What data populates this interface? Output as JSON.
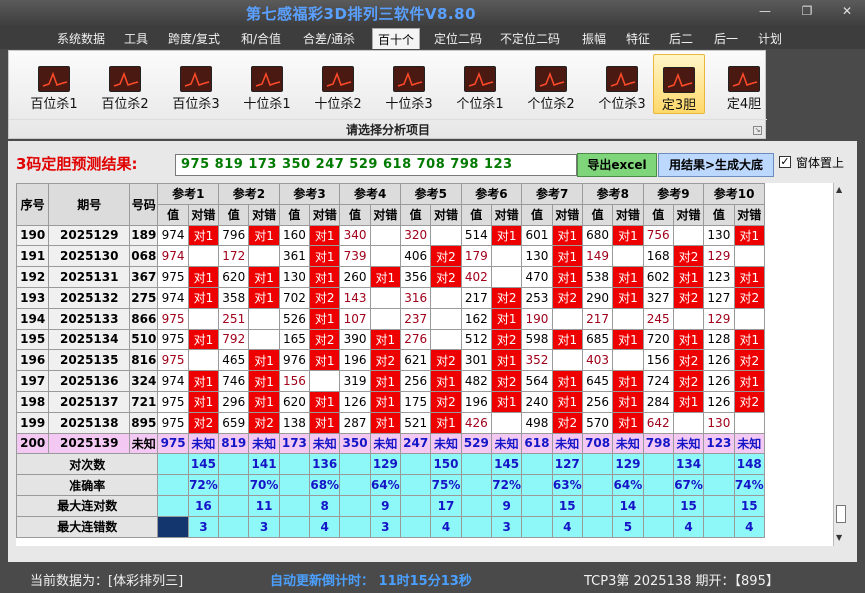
{
  "app": {
    "title": "第七感福彩3D排列三软件V8.80",
    "window_buttons": [
      "—",
      "❐",
      "✕"
    ]
  },
  "menu": [
    "系统数据",
    "工具",
    "跨度/复式",
    "和/合值",
    "合差/通杀",
    "百十个",
    "定位二码",
    "不定位二码",
    "振幅",
    "特征",
    "后二",
    "后一",
    "计划"
  ],
  "menu_active_index": 5,
  "ribbon": {
    "buttons": [
      "百位杀1",
      "百位杀2",
      "百位杀3",
      "十位杀1",
      "十位杀2",
      "十位杀3",
      "个位杀1",
      "个位杀2",
      "个位杀3",
      "定3胆",
      "定4胆"
    ],
    "selected_index": 9,
    "caption": "请选择分析项目"
  },
  "result": {
    "label": "3码定胆预测结果:",
    "value": "975 819 173 350 247 529 618 708 798 123",
    "export_button": "导出excel",
    "chart_button": "用结果>生成大底",
    "pin_checked": true,
    "pin_label": "窗体置上"
  },
  "grid": {
    "headers": {
      "seq": "序号",
      "issue": "期号",
      "code": "号码",
      "val": "值",
      "cmp": "对错"
    },
    "ref_names": [
      "参考1",
      "参考2",
      "参考3",
      "参考4",
      "参考5",
      "参考6",
      "参考7",
      "参考8",
      "参考9",
      "参考10"
    ],
    "rows": [
      {
        "seq": "190",
        "issue": "2025129",
        "code": "189",
        "refs": [
          [
            "974",
            "对1"
          ],
          [
            "796",
            "对1"
          ],
          [
            "160",
            "对1"
          ],
          [
            "340",
            ""
          ],
          [
            "320",
            ""
          ],
          [
            "514",
            "对1"
          ],
          [
            "601",
            "对1"
          ],
          [
            "680",
            "对1"
          ],
          [
            "756",
            ""
          ],
          [
            "130",
            "对1"
          ]
        ]
      },
      {
        "seq": "191",
        "issue": "2025130",
        "code": "068",
        "refs": [
          [
            "974",
            ""
          ],
          [
            "172",
            ""
          ],
          [
            "361",
            "对1"
          ],
          [
            "739",
            ""
          ],
          [
            "406",
            "对2"
          ],
          [
            "179",
            ""
          ],
          [
            "130",
            "对1"
          ],
          [
            "149",
            ""
          ],
          [
            "168",
            "对2"
          ],
          [
            "129",
            ""
          ]
        ]
      },
      {
        "seq": "192",
        "issue": "2025131",
        "code": "367",
        "refs": [
          [
            "975",
            "对1"
          ],
          [
            "620",
            "对1"
          ],
          [
            "130",
            "对1"
          ],
          [
            "260",
            "对1"
          ],
          [
            "356",
            "对2"
          ],
          [
            "402",
            ""
          ],
          [
            "470",
            "对1"
          ],
          [
            "538",
            "对1"
          ],
          [
            "602",
            "对1"
          ],
          [
            "123",
            "对1"
          ]
        ]
      },
      {
        "seq": "193",
        "issue": "2025132",
        "code": "275",
        "refs": [
          [
            "974",
            "对1"
          ],
          [
            "358",
            "对1"
          ],
          [
            "702",
            "对2"
          ],
          [
            "143",
            ""
          ],
          [
            "316",
            ""
          ],
          [
            "217",
            "对2"
          ],
          [
            "253",
            "对2"
          ],
          [
            "290",
            "对1"
          ],
          [
            "327",
            "对2"
          ],
          [
            "127",
            "对2"
          ]
        ]
      },
      {
        "seq": "194",
        "issue": "2025133",
        "code": "866",
        "refs": [
          [
            "975",
            ""
          ],
          [
            "251",
            ""
          ],
          [
            "526",
            "对1"
          ],
          [
            "107",
            ""
          ],
          [
            "237",
            ""
          ],
          [
            "162",
            "对1"
          ],
          [
            "190",
            ""
          ],
          [
            "217",
            ""
          ],
          [
            "245",
            ""
          ],
          [
            "129",
            ""
          ]
        ]
      },
      {
        "seq": "195",
        "issue": "2025134",
        "code": "510",
        "refs": [
          [
            "975",
            "对1"
          ],
          [
            "792",
            ""
          ],
          [
            "165",
            "对2"
          ],
          [
            "390",
            "对1"
          ],
          [
            "276",
            ""
          ],
          [
            "512",
            "对2"
          ],
          [
            "598",
            "对1"
          ],
          [
            "685",
            "对1"
          ],
          [
            "720",
            "对1"
          ],
          [
            "128",
            "对1"
          ]
        ]
      },
      {
        "seq": "196",
        "issue": "2025135",
        "code": "816",
        "refs": [
          [
            "975",
            ""
          ],
          [
            "465",
            "对1"
          ],
          [
            "976",
            "对1"
          ],
          [
            "196",
            "对2"
          ],
          [
            "621",
            "对2"
          ],
          [
            "301",
            "对1"
          ],
          [
            "352",
            ""
          ],
          [
            "403",
            ""
          ],
          [
            "156",
            "对2"
          ],
          [
            "126",
            "对2"
          ]
        ]
      },
      {
        "seq": "197",
        "issue": "2025136",
        "code": "324",
        "refs": [
          [
            "974",
            "对1"
          ],
          [
            "746",
            "对1"
          ],
          [
            "156",
            ""
          ],
          [
            "319",
            "对1"
          ],
          [
            "256",
            "对1"
          ],
          [
            "482",
            "对2"
          ],
          [
            "564",
            "对1"
          ],
          [
            "645",
            "对1"
          ],
          [
            "724",
            "对2"
          ],
          [
            "126",
            "对1"
          ]
        ]
      },
      {
        "seq": "198",
        "issue": "2025137",
        "code": "721",
        "refs": [
          [
            "975",
            "对1"
          ],
          [
            "296",
            "对1"
          ],
          [
            "620",
            "对1"
          ],
          [
            "126",
            "对1"
          ],
          [
            "175",
            "对2"
          ],
          [
            "196",
            "对1"
          ],
          [
            "240",
            "对1"
          ],
          [
            "256",
            "对1"
          ],
          [
            "284",
            "对1"
          ],
          [
            "126",
            "对2"
          ]
        ]
      },
      {
        "seq": "199",
        "issue": "2025138",
        "code": "895",
        "refs": [
          [
            "975",
            "对2"
          ],
          [
            "659",
            "对2"
          ],
          [
            "138",
            "对1"
          ],
          [
            "287",
            "对1"
          ],
          [
            "521",
            "对1"
          ],
          [
            "426",
            ""
          ],
          [
            "498",
            "对2"
          ],
          [
            "570",
            "对1"
          ],
          [
            "642",
            ""
          ],
          [
            "130",
            ""
          ]
        ]
      }
    ],
    "last_row": {
      "seq": "200",
      "issue": "2025139",
      "code": "未知",
      "values": [
        "975",
        "819",
        "173",
        "350",
        "247",
        "529",
        "618",
        "708",
        "798",
        "123"
      ],
      "status": "未知"
    },
    "stats": [
      {
        "label": "对次数",
        "values": [
          "145",
          "141",
          "136",
          "129",
          "150",
          "145",
          "127",
          "129",
          "134",
          "148"
        ]
      },
      {
        "label": "准确率",
        "values": [
          "72%",
          "70%",
          "68%",
          "64%",
          "75%",
          "72%",
          "63%",
          "64%",
          "67%",
          "74%"
        ]
      },
      {
        "label": "最大连对数",
        "values": [
          "16",
          "11",
          "8",
          "9",
          "17",
          "9",
          "15",
          "14",
          "15",
          "15"
        ]
      },
      {
        "label": "最大连错数",
        "values": [
          "3",
          "3",
          "4",
          "3",
          "4",
          "3",
          "4",
          "5",
          "4",
          "4"
        ]
      }
    ]
  },
  "status": {
    "data_source": "当前数据为：[体彩排列三]",
    "countdown": "自动更新倒计时： 11时15分13秒",
    "latest": "TCP3第 2025138 期开：【895】"
  },
  "colors": {
    "hit_red": "#ee0000",
    "stat_cyan": "#8ef7f7",
    "unknown_row": "#f3c9f3",
    "title_blue": "#5aa0ff"
  },
  "icons": {
    "ribbon": "trend-chart-icon"
  }
}
